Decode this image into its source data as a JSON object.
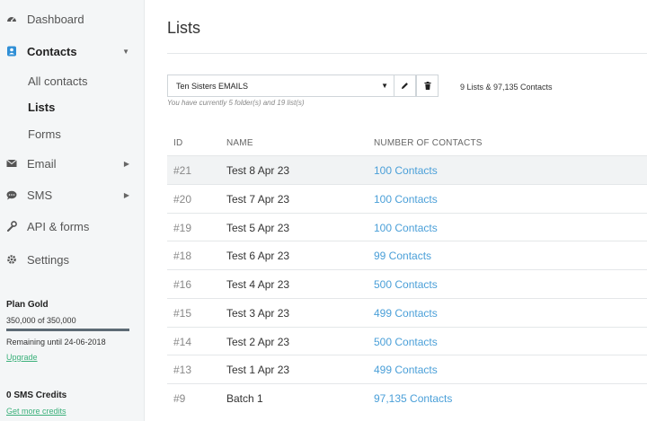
{
  "sidebar": {
    "items": [
      {
        "label": "Dashboard"
      },
      {
        "label": "Contacts"
      },
      {
        "label": "Email"
      },
      {
        "label": "SMS"
      },
      {
        "label": "API & forms"
      },
      {
        "label": "Settings"
      }
    ],
    "contacts_sub": [
      {
        "label": "All contacts"
      },
      {
        "label": "Lists"
      },
      {
        "label": "Forms"
      }
    ],
    "plan": {
      "title": "Plan Gold",
      "usage": "350,000 of 350,000",
      "usage_fraction": 1.0,
      "remaining": "Remaining until 24-06-2018",
      "upgrade": "Upgrade"
    },
    "sms": {
      "title": "0 SMS Credits",
      "link": "Get more credits"
    }
  },
  "main": {
    "title": "Lists",
    "folder_select": {
      "value": "Ten Sisters EMAILS"
    },
    "summary": "9 Lists & 97,135 Contacts",
    "hint": "You have currently 5 folder(s) and 19 list(s)",
    "table": {
      "headers": [
        "ID",
        "NAME",
        "NUMBER OF CONTACTS"
      ],
      "rows": [
        {
          "id": "#21",
          "name": "Test 8 Apr 23",
          "count": "100 Contacts"
        },
        {
          "id": "#20",
          "name": "Test 7 Apr 23",
          "count": "100 Contacts"
        },
        {
          "id": "#19",
          "name": "Test 5 Apr 23",
          "count": "100 Contacts"
        },
        {
          "id": "#18",
          "name": "Test 6 Apr 23",
          "count": "99 Contacts"
        },
        {
          "id": "#16",
          "name": "Test 4 Apr 23",
          "count": "500 Contacts"
        },
        {
          "id": "#15",
          "name": "Test 3 Apr 23",
          "count": "499 Contacts"
        },
        {
          "id": "#14",
          "name": "Test 2 Apr 23",
          "count": "500 Contacts"
        },
        {
          "id": "#13",
          "name": "Test 1 Apr 23",
          "count": "499 Contacts"
        },
        {
          "id": "#9",
          "name": "Batch 1",
          "count": "97,135 Contacts"
        }
      ]
    }
  },
  "colors": {
    "accent_link": "#4a9fd8",
    "green_link": "#3ab07a",
    "sidebar_bg": "#f4f6f7",
    "contacts_icon": "#2f8fd6"
  },
  "icons": [
    "dashboard-icon",
    "contacts-icon",
    "email-icon",
    "sms-icon",
    "api-icon",
    "settings-icon",
    "pencil-icon",
    "trash-icon",
    "caret-down-icon"
  ]
}
